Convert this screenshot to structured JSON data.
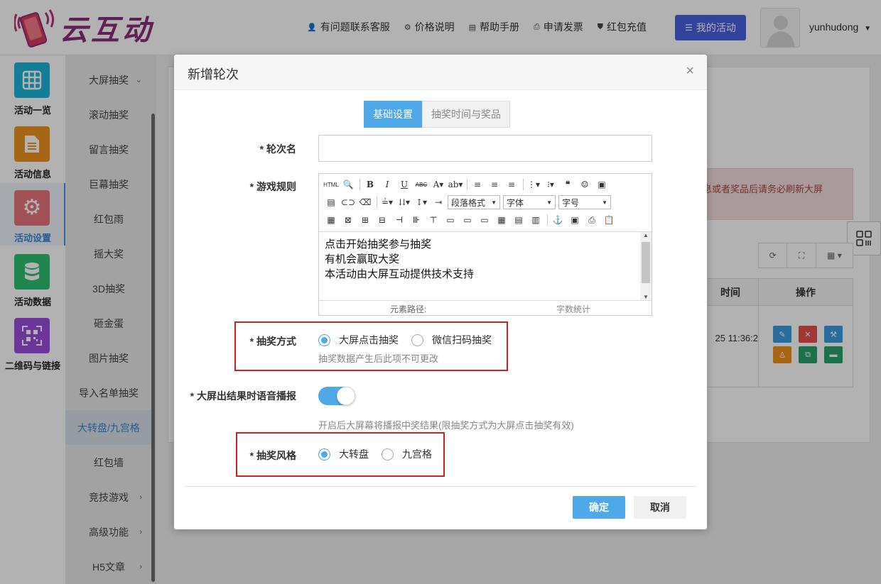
{
  "brand": {
    "name": "云互动"
  },
  "top_nav": {
    "items": [
      {
        "label": "有问题联系客服",
        "icon": "user-plus-icon"
      },
      {
        "label": "价格说明",
        "icon": "gear-icon"
      },
      {
        "label": "帮助手册",
        "icon": "book-icon"
      },
      {
        "label": "申请发票",
        "icon": "printer-icon"
      },
      {
        "label": "红包充值",
        "icon": "shield-check-icon"
      }
    ],
    "my_activity": "我的活动",
    "username": "yunhudong",
    "accent_color": "#4a5fe0"
  },
  "side_icons": [
    {
      "label": "活动一览",
      "color": "#1fb4d8",
      "icon": "grid-icon"
    },
    {
      "label": "活动信息",
      "color": "#f0931e",
      "icon": "document-icon"
    },
    {
      "label": "活动设置",
      "color": "#e8747c",
      "icon": "gear-icon",
      "active": true
    },
    {
      "label": "活动数据",
      "color": "#2fbf71",
      "icon": "database-icon"
    },
    {
      "label": "二维码与链接",
      "color": "#9b4ddb",
      "icon": "qrcode-icon"
    }
  ],
  "sub_menu": [
    {
      "label": "大屏抽奖",
      "chev": "⌄"
    },
    {
      "label": "滚动抽奖"
    },
    {
      "label": "留言抽奖"
    },
    {
      "label": "巨幕抽奖"
    },
    {
      "label": "红包雨"
    },
    {
      "label": "摇大奖"
    },
    {
      "label": "3D抽奖"
    },
    {
      "label": "砸金蛋"
    },
    {
      "label": "图片抽奖"
    },
    {
      "label": "导入名单抽奖"
    },
    {
      "label": "大转盘/九宫格",
      "active": true
    },
    {
      "label": "红包墙"
    },
    {
      "label": "竞技游戏",
      "chev": "›"
    },
    {
      "label": "高级功能",
      "chev": "›"
    },
    {
      "label": "H5文章",
      "chev": "›"
    }
  ],
  "background": {
    "alert_text": "息或者奖品后请务必刷新大屏",
    "table_headers": {
      "time": "时间",
      "ops": "操作"
    },
    "row_time": "25 11:36:2"
  },
  "modal": {
    "title": "新增轮次",
    "close": "×",
    "tabs": [
      "基础设置",
      "抽奖时间与奖品"
    ],
    "round_name": {
      "label": "* 轮次名",
      "value": "",
      "placeholder": ""
    },
    "rules": {
      "label": "* 游戏规则",
      "paragraph_format": "段落格式",
      "font_family": "字体",
      "font_size": "字号",
      "lines": [
        "点击开始抽奖参与抽奖",
        "有机会赢取大奖",
        "本活动由大屏互动提供技术支持"
      ],
      "element_path": "元素路径:",
      "word_count": "字数统计"
    },
    "draw_mode": {
      "label": "* 抽奖方式",
      "options": [
        "大屏点击抽奖",
        "微信扫码抽奖"
      ],
      "selected": "大屏点击抽奖",
      "hint": "抽奖数据产生后此项不可更改"
    },
    "voice": {
      "label": "* 大屏出结果时语音播报",
      "on": true,
      "hint": "开启后大屏幕将播报中奖结果(限抽奖方式为大屏点击抽奖有效)"
    },
    "style": {
      "label": "* 抽奖风格",
      "options": [
        "大转盘",
        "九宫格"
      ],
      "selected": "大转盘"
    },
    "confirm": "确定",
    "cancel": "取消",
    "primary_color": "#4fa8e8"
  }
}
